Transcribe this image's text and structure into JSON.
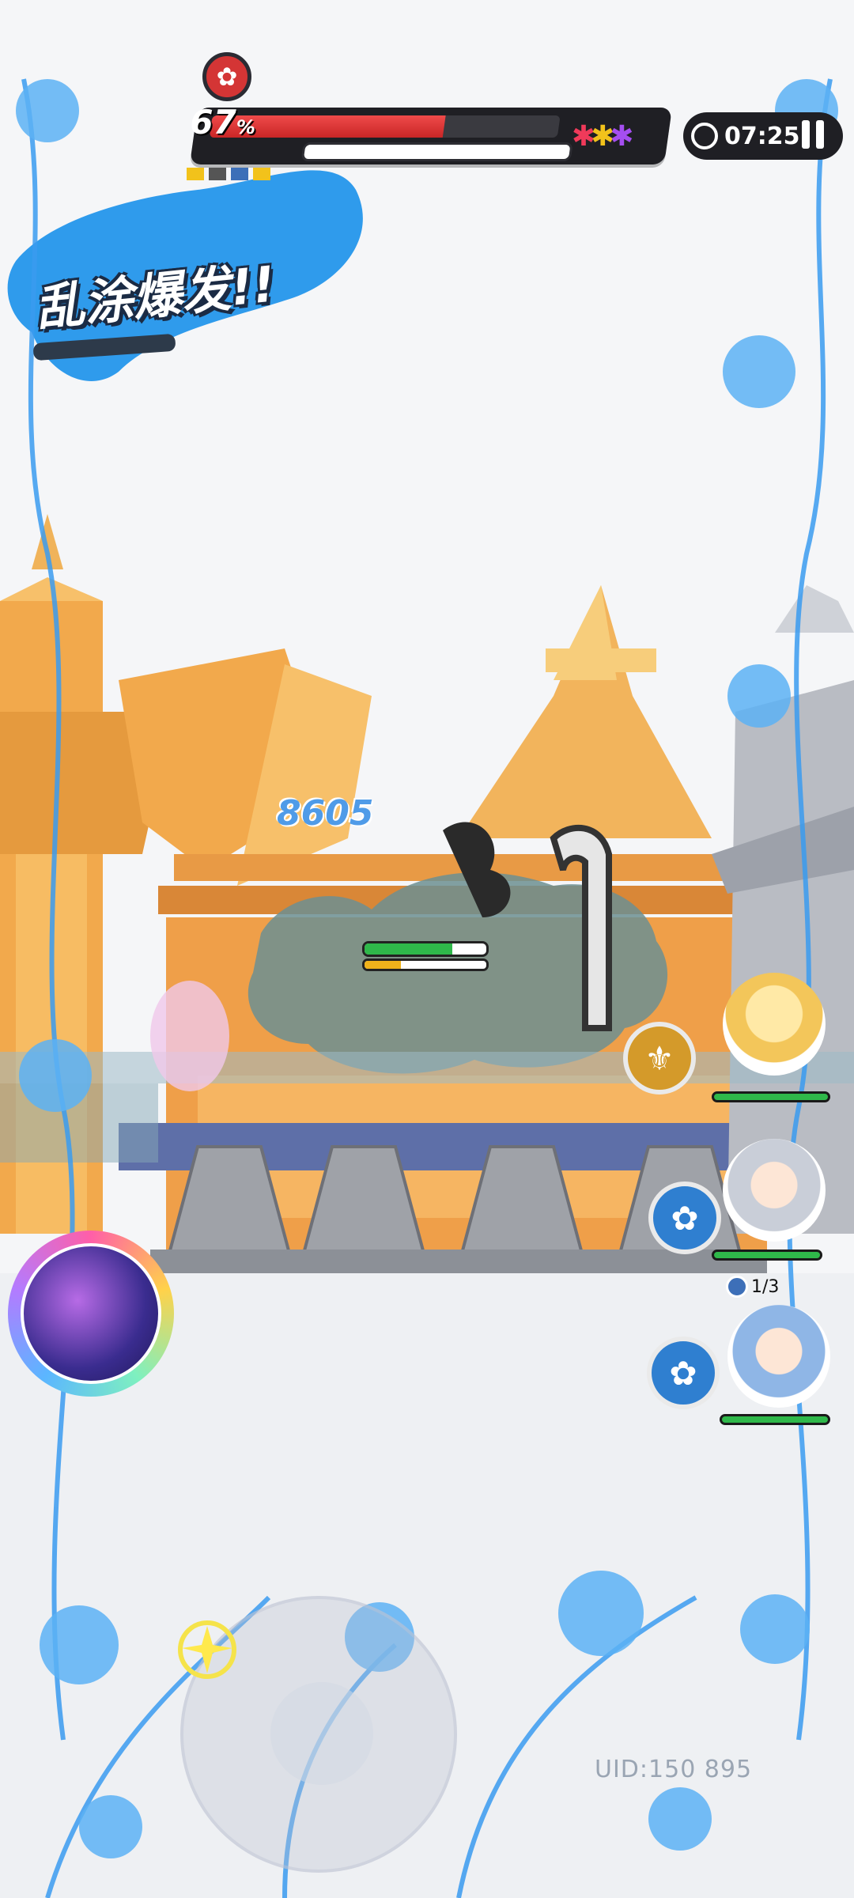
{
  "hud": {
    "boss_hp_percent_value": "67",
    "boss_hp_percent_sign": "%",
    "boss_hp_fill": 0.67,
    "timer": "07:25",
    "scribble_burst_label": "乱涂爆发!!",
    "paint_icons": [
      "red-paint-icon",
      "yellow-paint-icon",
      "purple-paint-icon"
    ]
  },
  "combat": {
    "damage_number": "8605",
    "enemy_hp_fill": 0.72,
    "enemy_stagger_fill": 0.3
  },
  "party": {
    "members": [
      {
        "name": "blonde-character",
        "hp_fill": 1.0
      },
      {
        "name": "silver-hair-character",
        "hp_fill": 1.0,
        "charge": "1/3"
      },
      {
        "name": "blue-hair-character",
        "hp_fill": 1.0
      }
    ]
  },
  "footer": {
    "uid": "UID:150 895"
  },
  "colors": {
    "accent_blue": "#3f9be8",
    "hp_red": "#d43535",
    "hp_green": "#2fb84a",
    "stagger_yellow": "#f0b21b"
  }
}
